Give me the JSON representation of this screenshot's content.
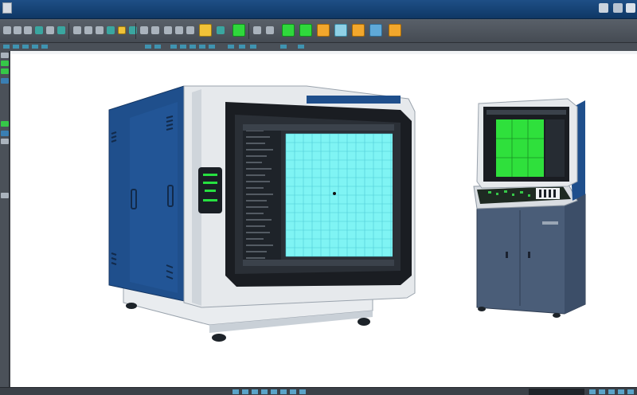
{
  "window": {
    "title": ""
  },
  "toolbar": {
    "buttons": [
      "toolbar-button",
      "toolbar-button",
      "toolbar-button",
      "toolbar-button",
      "toolbar-button",
      "toolbar-button",
      "toolbar-button",
      "toolbar-button"
    ]
  },
  "canvas": {
    "large_machine": {
      "name_plate": "",
      "screen_grid_color": "#7ff4f4",
      "status_lights_color": "#26e040"
    },
    "small_cabinet": {
      "screen_color": "#2fe03c",
      "body_color": "#4a5d78"
    }
  },
  "colors": {
    "titlebar": "#1e4f86",
    "toolbar": "#596069",
    "canvas": "#ffffff",
    "machine_blue": "#1f4f8c",
    "machine_white": "#e6e9ec"
  }
}
